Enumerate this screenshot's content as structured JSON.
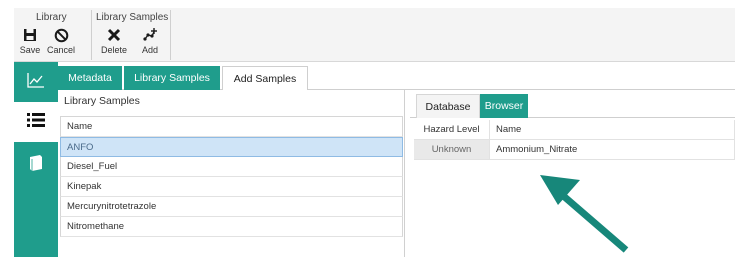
{
  "ribbon": {
    "groups": [
      {
        "title": "Library"
      },
      {
        "title": "Library Samples"
      }
    ],
    "buttons": {
      "save": "Save",
      "cancel": "Cancel",
      "delete": "Delete",
      "add": "Add"
    }
  },
  "rail": {
    "items": [
      {
        "icon": "line-chart-icon"
      },
      {
        "icon": "list-icon"
      },
      {
        "icon": "book-icon"
      }
    ]
  },
  "tabs": [
    "Metadata",
    "Library Samples",
    "Add Samples"
  ],
  "active_tab": "Add Samples",
  "library_samples": {
    "title": "Library Samples",
    "column": "Name",
    "items": [
      "ANFO",
      "Diesel_Fuel",
      "Kinepak",
      "Mercurynitrotetrazole",
      "Nitromethane"
    ],
    "selected": "ANFO"
  },
  "right_panel": {
    "tabs": [
      "Database",
      "Browser"
    ],
    "active_tab": "Browser",
    "columns": [
      "Hazard Level",
      "Name"
    ],
    "rows": [
      {
        "hazard": "Unknown",
        "name": "Ammonium_Nitrate"
      }
    ]
  },
  "colors": {
    "accent": "#1f9d8c",
    "selection": "#cfe4f7",
    "arrow": "#17877a"
  }
}
